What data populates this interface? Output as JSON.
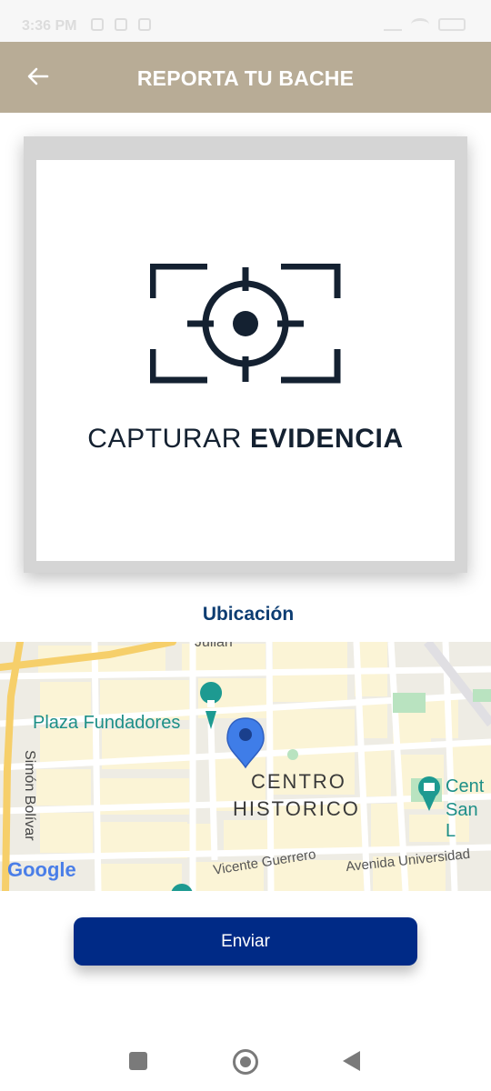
{
  "status_bar": {
    "time": "3:36 PM"
  },
  "app_bar": {
    "title": "REPORTA TU BACHE",
    "back_icon": "arrow-left-icon"
  },
  "evidence": {
    "icon": "camera-target-icon",
    "label_regular": "CAPTURAR ",
    "label_bold": "EVIDENCIA"
  },
  "location": {
    "label": "Ubicación"
  },
  "map": {
    "labels": {
      "plaza": "Plaza Fundadores",
      "centro_1": "CENTRO",
      "centro_2": "HISTORICO",
      "simon": "Simón Bolívar",
      "vicente": "Vicente Guerrero",
      "avenida": "Avenida Universidad",
      "julian": "Julian",
      "centro_san_1": "Cent",
      "centro_san_2": "San L",
      "google": "Google"
    },
    "colors": {
      "road_major": "#f6cf6a",
      "block": "#fbf4d6",
      "pin": "#3f7de8",
      "poi_teal": "#1d9a91"
    }
  },
  "actions": {
    "send_label": "Enviar"
  },
  "colors": {
    "app_bar": "#b8ac96",
    "primary_button": "#002a86",
    "location_label": "#0d3d72"
  }
}
